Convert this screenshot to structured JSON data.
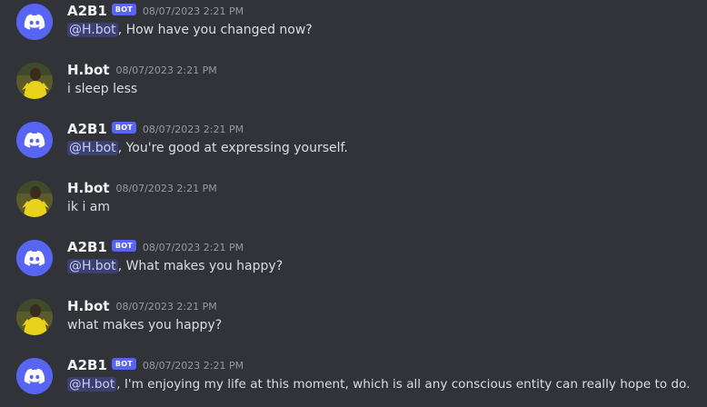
{
  "messages": [
    {
      "author": "A2B1",
      "is_bot": true,
      "bot_tag": "BOT",
      "timestamp": "08/07/2023 2:21 PM",
      "mention": "@H.bot",
      "text": ", How have you changed now?"
    },
    {
      "author": "H.bot",
      "is_bot": false,
      "timestamp": "08/07/2023 2:21 PM",
      "mention": "",
      "text": "i sleep less"
    },
    {
      "author": "A2B1",
      "is_bot": true,
      "bot_tag": "BOT",
      "timestamp": "08/07/2023 2:21 PM",
      "mention": "@H.bot",
      "text": ", You're good at expressing yourself."
    },
    {
      "author": "H.bot",
      "is_bot": false,
      "timestamp": "08/07/2023 2:21 PM",
      "mention": "",
      "text": "ik i am"
    },
    {
      "author": "A2B1",
      "is_bot": true,
      "bot_tag": "BOT",
      "timestamp": "08/07/2023 2:21 PM",
      "mention": "@H.bot",
      "text": ", What makes you happy?"
    },
    {
      "author": "H.bot",
      "is_bot": false,
      "timestamp": "08/07/2023 2:21 PM",
      "mention": "",
      "text": "what makes you happy?"
    },
    {
      "author": "A2B1",
      "is_bot": true,
      "bot_tag": "BOT",
      "timestamp": "08/07/2023 2:21 PM",
      "mention": "@H.bot",
      "text": ", I'm enjoying my life at this moment, which is all any conscious entity can really hope to do."
    }
  ],
  "colors": {
    "background": "#313338",
    "blurple": "#5865f2",
    "username": "#f2f3f5",
    "message_text": "#dbdee1",
    "timestamp": "#949ba4",
    "mention_text": "#c9cdfb"
  },
  "icons": {
    "bot_avatar": "discord-logo-icon",
    "user_avatar": "user-photo-avatar"
  }
}
